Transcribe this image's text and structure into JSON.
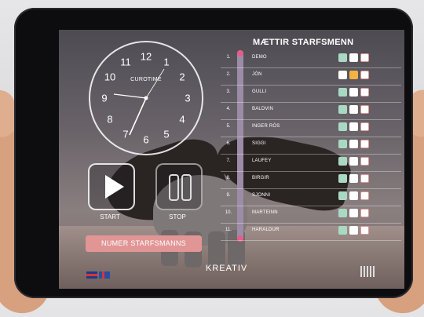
{
  "clock": {
    "label": "CUROTIME",
    "numbers": [
      "12",
      "1",
      "2",
      "3",
      "4",
      "5",
      "6",
      "7",
      "8",
      "9",
      "10",
      "11"
    ]
  },
  "controls": {
    "start_label": "START",
    "stop_label": "STOP",
    "numer_button": "NUMER STARFSMANNS"
  },
  "list": {
    "title": "MÆTTIR STARFSMENN",
    "rows": [
      {
        "index": "1.",
        "name": "DEMO",
        "marks": [
          "g",
          "w",
          "r"
        ]
      },
      {
        "index": "2.",
        "name": "JÓN",
        "marks": [
          "w",
          "o",
          "r"
        ]
      },
      {
        "index": "3.",
        "name": "GULLI",
        "marks": [
          "g",
          "w",
          "r"
        ]
      },
      {
        "index": "4.",
        "name": "BALDVIN",
        "marks": [
          "g",
          "w",
          "r"
        ]
      },
      {
        "index": "5.",
        "name": "INGER RÓS",
        "marks": [
          "g",
          "w",
          "r"
        ]
      },
      {
        "index": "6.",
        "name": "SIGGI",
        "marks": [
          "g",
          "w",
          "r"
        ]
      },
      {
        "index": "7.",
        "name": "LAUFEY",
        "marks": [
          "g",
          "w",
          "r"
        ]
      },
      {
        "index": "8.",
        "name": "BIRGIR",
        "marks": [
          "g",
          "w",
          "r"
        ]
      },
      {
        "index": "9.",
        "name": "SJONNI",
        "marks": [
          "g",
          "w",
          "r"
        ]
      },
      {
        "index": "10.",
        "name": "MARTEINN",
        "marks": [
          "g",
          "w",
          "r"
        ]
      },
      {
        "index": "11.",
        "name": "HARALDUR",
        "marks": [
          "g",
          "w",
          "r"
        ]
      }
    ]
  },
  "footer": {
    "brand": "KREATIV"
  },
  "colors": {
    "present_green": "#a9d9c3",
    "late_orange": "#f2b244",
    "absent_red": "#e29595"
  }
}
